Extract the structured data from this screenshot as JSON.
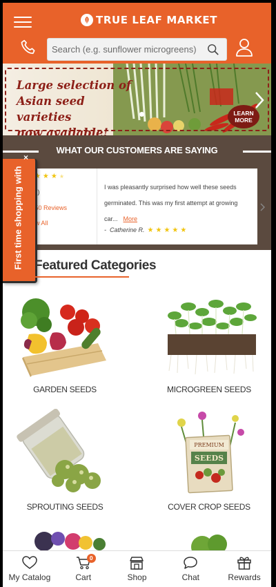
{
  "header": {
    "logo_text": "TRUE LEAF MARKET",
    "search_placeholder": "Search (e.g. sunflower microgreens)",
    "brand_color": "#e8622a"
  },
  "banner": {
    "text_line1": "Large selection of",
    "text_line2": "Asian seed varieties",
    "text_line3": "now available!",
    "learn_more_line1": "LEARN",
    "learn_more_line2": "MORE"
  },
  "reviews": {
    "title": "WHAT OUR CUSTOMERS ARE SAYING",
    "rating": "(4.8)",
    "count": "5,250 Reviews",
    "view_all": "View All",
    "quote": "I was pleasantly surprised how well these seeds germinated. This was my first attempt at growing car...",
    "more": "More",
    "author": "Catherine R.",
    "author_stars": 5,
    "avg_stars": 4.8
  },
  "side_tab": {
    "label": "First time shopping with"
  },
  "categories": {
    "heading": "Featured Categories",
    "items": [
      {
        "label": "GARDEN SEEDS",
        "icon": "vegetables-crate"
      },
      {
        "label": "MICROGREEN SEEDS",
        "icon": "microgreens"
      },
      {
        "label": "SPROUTING SEEDS",
        "icon": "sprout-jar"
      },
      {
        "label": "COVER CROP SEEDS",
        "icon": "seed-packet"
      }
    ]
  },
  "bottom_nav": {
    "items": [
      {
        "label": "My Catalog",
        "icon": "heart-icon"
      },
      {
        "label": "Cart",
        "icon": "cart-icon",
        "badge": "0"
      },
      {
        "label": "Shop",
        "icon": "store-icon"
      },
      {
        "label": "Chat",
        "icon": "chat-icon"
      },
      {
        "label": "Rewards",
        "icon": "gift-icon"
      }
    ]
  }
}
